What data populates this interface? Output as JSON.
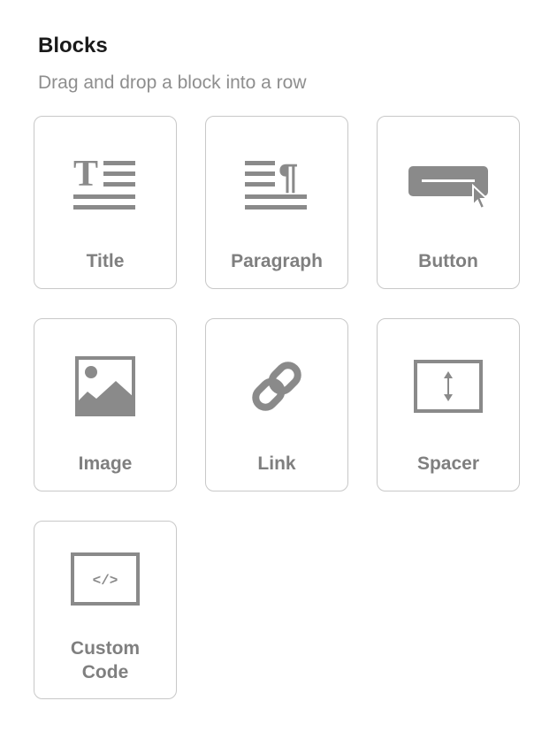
{
  "panel": {
    "title": "Blocks",
    "subtitle": "Drag and drop a block into a row"
  },
  "blocks": [
    {
      "label": "Title",
      "icon": "title-icon"
    },
    {
      "label": "Paragraph",
      "icon": "paragraph-icon"
    },
    {
      "label": "Button",
      "icon": "button-icon"
    },
    {
      "label": "Image",
      "icon": "image-icon"
    },
    {
      "label": "Link",
      "icon": "link-icon"
    },
    {
      "label": "Spacer",
      "icon": "spacer-icon"
    },
    {
      "label_line1": "Custom",
      "label_line2": "Code",
      "icon": "code-icon"
    }
  ],
  "colors": {
    "icon": "#8a8a8a",
    "border": "#c8c8c8",
    "label": "#7f7f7f"
  }
}
